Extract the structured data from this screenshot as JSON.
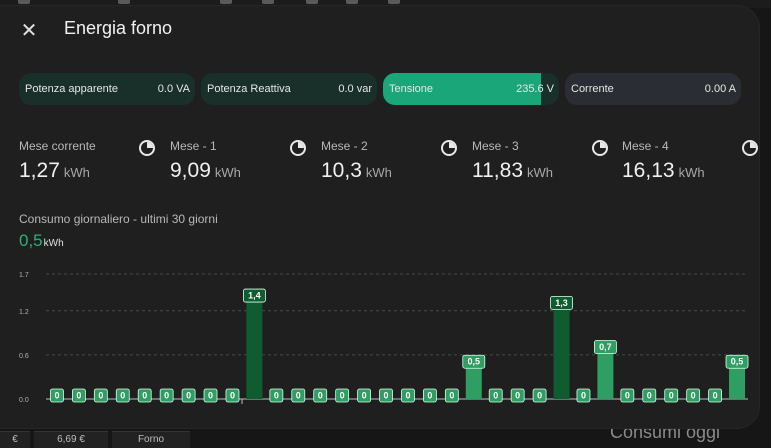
{
  "dialog": {
    "title": "Energia forno",
    "pills": [
      {
        "label": "Potenza apparente",
        "value": "0.0 VA",
        "fill": 0
      },
      {
        "label": "Potenza Reattiva",
        "value": "0.0 var",
        "fill": 0
      },
      {
        "label": "Tensione",
        "value": "235.6 V",
        "fill": 0.9
      },
      {
        "label": "Corrente",
        "value": "0.00 A",
        "fill": 0
      }
    ],
    "stats": [
      {
        "label": "Mese corrente",
        "value": "1,27",
        "unit": "kWh",
        "icon": "pie-chart-icon"
      },
      {
        "label": "Mese - 1",
        "value": "9,09",
        "unit": "kWh",
        "icon": "pie-chart-icon"
      },
      {
        "label": "Mese - 2",
        "value": "10,3",
        "unit": "kWh",
        "icon": "pie-chart-icon"
      },
      {
        "label": "Mese - 3",
        "value": "11,83",
        "unit": "kWh",
        "icon": "pie-chart-icon"
      },
      {
        "label": "Mese - 4",
        "value": "16,13",
        "unit": "kWh",
        "icon": "pie-chart-icon"
      }
    ],
    "daily": {
      "title": "Consumo giornaliero - ultimi 30 giorni",
      "value": "0,5",
      "unit": "kWh"
    }
  },
  "background": {
    "bottom_value": "6,69 €",
    "bottom_label": "Forno",
    "big_text": "Consumi oggi"
  },
  "colors": {
    "accent": "#1aa679",
    "bar_light": "#2e9e63",
    "bar_dark": "#0e5c30",
    "highlight_value": "#28b27c"
  },
  "chart_data": {
    "type": "bar",
    "title": "",
    "xlabel": "",
    "ylabel": "",
    "ylim": [
      0,
      1.7
    ],
    "yticks": [
      "0.0",
      "0.6",
      "1.2",
      "1.7"
    ],
    "grid": true,
    "values": [
      0,
      0,
      0,
      0,
      0,
      0,
      0,
      0,
      0,
      1.4,
      0,
      0,
      0,
      0,
      0,
      0,
      0,
      0,
      0,
      0.5,
      0,
      0,
      0,
      1.3,
      0,
      0.7,
      0,
      0,
      0,
      0,
      0,
      0.5
    ],
    "labels": [
      "0",
      "0",
      "0",
      "0",
      "0",
      "0",
      "0",
      "0",
      "0",
      "1,4",
      "0",
      "0",
      "0",
      "0",
      "0",
      "0",
      "0",
      "0",
      "0",
      "0,5",
      "0",
      "0",
      "0",
      "1,3",
      "0",
      "0,7",
      "0",
      "0",
      "0",
      "0",
      "0",
      "0,5"
    ],
    "dark": [
      false,
      false,
      false,
      false,
      false,
      false,
      false,
      false,
      false,
      true,
      false,
      false,
      false,
      false,
      false,
      false,
      false,
      false,
      false,
      false,
      false,
      false,
      false,
      true,
      false,
      false,
      false,
      false,
      false,
      false,
      false,
      false
    ]
  }
}
